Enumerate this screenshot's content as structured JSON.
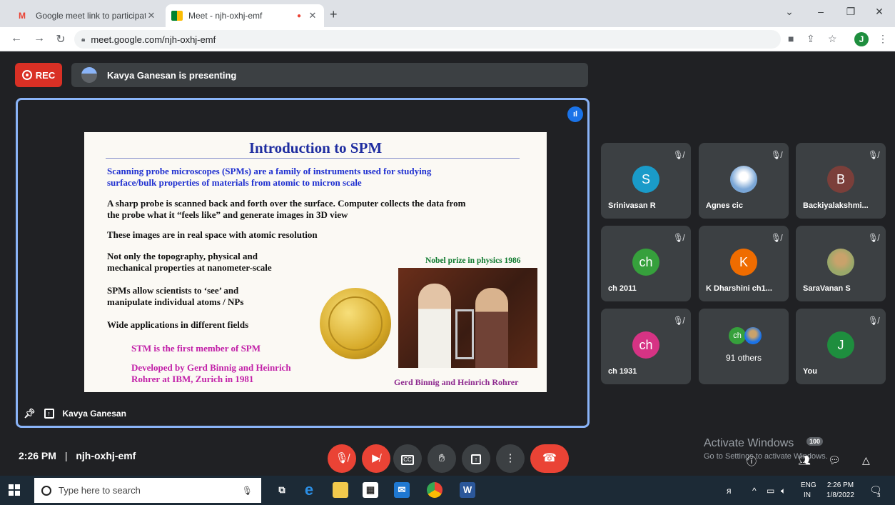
{
  "browser": {
    "tabs": [
      {
        "title": "Google meet link to participate t",
        "active": false
      },
      {
        "title": "Meet - njh-oxhj-emf",
        "active": true
      }
    ],
    "new_tab": "+",
    "url": "meet.google.com/njh-oxhj-emf",
    "profile_initial": "J",
    "window_controls": {
      "dropdown": "⌄",
      "minimize": "–",
      "restore": "❐",
      "close": "✕"
    }
  },
  "meet": {
    "rec_label": "REC",
    "presenting_text": "Kavya Ganesan is presenting",
    "presenter_name": "Kavya Ganesan",
    "slide": {
      "title": "Introduction to SPM",
      "intro_line1": "Scanning probe microscopes (SPMs) are a family of instruments used for studying",
      "intro_line2": "surface/bulk properties of materials from atomic to micron scale",
      "p1_line1": "A sharp probe is scanned back and forth over the surface. Computer collects the data from",
      "p1_line2": "the probe what it “feels like” and generate images in 3D view",
      "p2": "These images are in real space with atomic resolution",
      "p3_line1": "Not only the topography, physical and",
      "p3_line2": "mechanical properties at nanometer-scale",
      "p4_line1": "SPMs allow scientists to ‘see’ and",
      "p4_line2": "manipulate individual atoms / NPs",
      "p5": "Wide applications in different fields",
      "stm": "STM is the first member of SPM",
      "dev_line1": "Developed by Gerd Binnig and Heinrich",
      "dev_line2": "Rohrer at IBM, Zurich in 1981",
      "nobel_caption": "Nobel prize in physics 1986",
      "photo_caption": "Gerd Binnig and Heinrich Rohrer"
    },
    "participants": [
      {
        "name": "Srinivasan R",
        "initial": "S",
        "color": "#1a9bc9"
      },
      {
        "name": "Agnes cic",
        "initial": "",
        "color": "#7aa6d6"
      },
      {
        "name": "Backiyalakshmi...",
        "initial": "B",
        "color": "#7b3f3a"
      },
      {
        "name": "ch 2011",
        "initial": "ch",
        "color": "#36a03c"
      },
      {
        "name": "K Dharshini ch1...",
        "initial": "K",
        "color": "#ef6c00"
      },
      {
        "name": "SaraVanan S",
        "initial": "",
        "color": "#9aa86a"
      },
      {
        "name": "ch 1931",
        "initial": "ch",
        "color": "#d63384"
      },
      {
        "name": "91 others",
        "initial": "ch",
        "color": "#36a03c"
      },
      {
        "name": "You",
        "initial": "J",
        "color": "#1e8e3e"
      }
    ],
    "bottom": {
      "time": "2:26 PM",
      "separator": "|",
      "meeting_code": "njh-oxhj-emf",
      "people_count": "100"
    },
    "activate_windows": {
      "line1": "Activate Windows",
      "line2": "Go to Settings to activate Windows."
    }
  },
  "taskbar": {
    "search_placeholder": "Type here to search",
    "language": "ENG",
    "region": "IN",
    "clock_time": "2:26 PM",
    "clock_date": "1/8/2022",
    "notification_count": "3"
  }
}
